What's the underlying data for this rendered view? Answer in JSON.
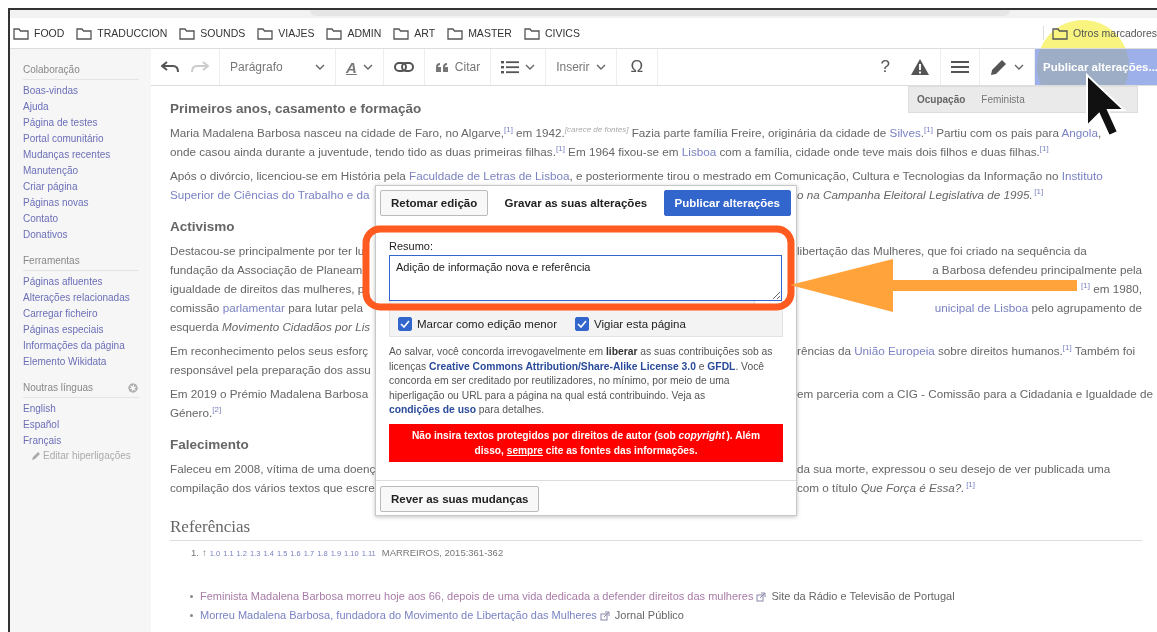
{
  "browser": {
    "bookmarks": [
      "FOOD",
      "TRADUCCION",
      "SOUNDS",
      "VIAJES",
      "ADMIN",
      "ART",
      "MASTER",
      "CIVICS"
    ],
    "other_bookmarks": "Otros marcadores"
  },
  "sidebar": [
    {
      "title": "Colaboração",
      "settings_icon": false,
      "items": [
        "Boas-vindas",
        "Ajuda",
        "Página de testes",
        "Portal comunitário",
        "Mudanças recentes",
        "Manutenção",
        "Criar página",
        "Páginas novas",
        "Contato",
        "Donativos"
      ]
    },
    {
      "title": "Ferramentas",
      "settings_icon": false,
      "items": [
        "Páginas afluentes",
        "Alterações relacionadas",
        "Carregar ficheiro",
        "Páginas especiais",
        "Informações da página",
        "Elemento Wikidata"
      ]
    },
    {
      "title": "Noutras línguas",
      "settings_icon": true,
      "items": [
        "English",
        "Español",
        "Français"
      ],
      "edit_link": "Editar hiperligações"
    }
  ],
  "toolbar": {
    "paragraph_format": "Parágrafo",
    "text_style": "A",
    "cite": "Citar",
    "insert": "Inserir",
    "special_character": "Ω",
    "help": "?",
    "publish": "Publicar alterações..."
  },
  "infobox": [
    {
      "label": "Ocupação",
      "value": "Feminista"
    }
  ],
  "article": [
    {
      "kind": "heading",
      "text": "Primeiros anos, casamento e formação"
    },
    {
      "kind": "paragraph",
      "lines": [
        {
          "kind": "full",
          "text": [
            "Maria Madalena Barbosa nasceu na cidade de Faro, no Algarve,",
            {
              "kind": "ref",
              "text": "[1]"
            },
            " em 1942.",
            {
              "kind": "note",
              "text": "[carece de fontes]"
            },
            " Fazia parte família Freire, originária da cidade de ",
            {
              "kind": "link",
              "text": "Silves"
            },
            ".",
            {
              "kind": "ref",
              "text": "[1]"
            },
            " Partiu com os pais para ",
            {
              "kind": "link",
              "text": "Angola"
            },
            ","
          ]
        },
        {
          "kind": "full",
          "text": [
            "onde casou ainda durante a juventude, tendo tido as duas primeiras filhas.",
            {
              "kind": "ref",
              "text": "[1]"
            },
            " Em 1964 fixou-se em ",
            {
              "kind": "link",
              "text": "Lisboa"
            },
            " com a família, cidade onde teve mais dois filhos e duas filhas.",
            {
              "kind": "ref",
              "text": "[1]"
            }
          ]
        }
      ]
    },
    {
      "kind": "paragraph",
      "lines": [
        {
          "kind": "full",
          "text": [
            "Após o divórcio, licenciou-se em História pela ",
            {
              "kind": "link",
              "text": "Faculdade de Letras de Lisboa"
            },
            ", e posteriormente tirou o mestrado em Comunicação, Cultura e Tecnologias da Informação no ",
            {
              "kind": "link",
              "text": "Instituto"
            }
          ]
        },
        {
          "kind": "split",
          "left": [
            {
              "kind": "link",
              "text": "Superior de Ciências do Trabalho e da"
            }
          ],
          "right": [
            {
              "kind": "italic",
              "text": "o na Campanha Eleitoral Legislativa de 1995."
            },
            {
              "kind": "ref",
              "text": "[1]"
            }
          ]
        }
      ]
    },
    {
      "kind": "heading",
      "text": "Activismo"
    },
    {
      "kind": "paragraph",
      "lines": [
        {
          "kind": "split",
          "left": [
            "Destacou-se principalmente por ter lu"
          ],
          "right": [
            "libertação das Mulheres, que foi criado na sequência da"
          ]
        },
        {
          "kind": "split_end",
          "left": [
            "fundação da Associação de Planeam"
          ],
          "right": [
            "a Barbosa defendeu principalmente pela"
          ]
        },
        {
          "kind": "split_end",
          "left": [
            "igualdade de direitos das mulheres, p"
          ],
          "right": [
            {
              "kind": "ref",
              "text": "[1]"
            },
            " em 1980,"
          ]
        },
        {
          "kind": "split_end",
          "left": [
            "comissão ",
            {
              "kind": "link",
              "text": "parlamentar"
            },
            " para lutar pela"
          ],
          "right": [
            {
              "kind": "link",
              "text": "unicipal de Lisboa"
            },
            " pelo agrupamento de"
          ]
        },
        {
          "kind": "split",
          "left": [
            "esquerda ",
            {
              "kind": "italic",
              "text": "Movimento Cidadãos por Lis"
            }
          ]
        }
      ]
    },
    {
      "kind": "paragraph",
      "lines": [
        {
          "kind": "split",
          "left": [
            "Em reconhecimento pelos seus esforç"
          ],
          "right": [
            "rências da ",
            {
              "kind": "link",
              "text": "União Europeia"
            },
            " sobre direitos humanos.",
            {
              "kind": "ref",
              "text": "[1]"
            },
            " Também foi"
          ]
        },
        {
          "kind": "split",
          "left": [
            "responsável pela preparação dos assu"
          ]
        }
      ]
    },
    {
      "kind": "paragraph",
      "lines": [
        {
          "kind": "split",
          "left": [
            "Em 2019 o Prémio Madalena Barbosa"
          ],
          "right": [
            "em parceria com a CIG - Comissão para a Cidadania e Igualdade de"
          ]
        },
        {
          "kind": "split",
          "left": [
            "Género.",
            {
              "kind": "ref",
              "text": "[2]"
            }
          ]
        }
      ]
    },
    {
      "kind": "heading",
      "text": "Falecimento"
    },
    {
      "kind": "paragraph",
      "lines": [
        {
          "kind": "split",
          "left": [
            "Faleceu em 2008, vítima de uma doenç"
          ],
          "right": [
            "da sua morte, expressou o seu desejo de ver publicada uma"
          ]
        },
        {
          "kind": "split",
          "left": [
            "compilação dos vários textos que escre"
          ],
          "right": [
            "com o título ",
            {
              "kind": "italic",
              "text": "Que Força é Essa?."
            },
            {
              "kind": "ref",
              "text": "[1]"
            }
          ]
        }
      ]
    }
  ],
  "references": {
    "title": "Referências",
    "items": [
      {
        "number": "1.",
        "arrow": "↑",
        "backlinks": [
          "1.0",
          "1.1",
          "1.2",
          "1.3",
          "1.4",
          "1.5",
          "1.6",
          "1.7",
          "1.8",
          "1.9",
          "1.10",
          "1.11"
        ],
        "text": "MARREIROS, 2015:361-362"
      }
    ]
  },
  "external_links": [
    {
      "title": "Feminista Madalena Barbosa morreu hoje aos 66, depois de uma vida dedicada a defender direitos das mulheres",
      "source": "Site da Rádio e Televisão de Portugal",
      "visited": true
    },
    {
      "title": "Morreu Madalena Barbosa, fundadora do Movimento de Libertação das Mulheres",
      "source": "Jornal Público",
      "visited": false
    }
  ],
  "dialog": {
    "resume_button": "Retomar edição",
    "title": "Gravar as suas alterações",
    "publish_button": "Publicar alterações",
    "summary_label": "Resumo:",
    "summary_value": "Adição de informação nova e referência",
    "options": [
      {
        "label": "Marcar como edição menor",
        "checked": true
      },
      {
        "label": "Vigiar esta página",
        "checked": true
      }
    ],
    "license_text": [
      "Ao salvar, você concorda irrevogavelmente em ",
      {
        "kind": "bold",
        "text": "liberar"
      },
      " as suas contribuições sob as licenças ",
      {
        "kind": "link",
        "text": "Creative Commons Attribution/Share-Alike License 3.0"
      },
      " e ",
      {
        "kind": "link",
        "text": "GFDL"
      },
      ". Você concorda em ser creditado por reutilizadores, no mínimo, por meio de uma hiperligação ou URL para a página na qual está contribuindo. Veja as ",
      {
        "kind": "link",
        "text": "condições de uso"
      },
      " para detalhes."
    ],
    "warning": [
      "Não insira textos protegidos por direitos de autor (sob ",
      {
        "kind": "italic",
        "text": "copyright"
      },
      "). Além disso, ",
      {
        "kind": "underline",
        "text": "sempre"
      },
      " cite as fontes das informações."
    ],
    "review_button": "Rever as suas mudanças"
  }
}
